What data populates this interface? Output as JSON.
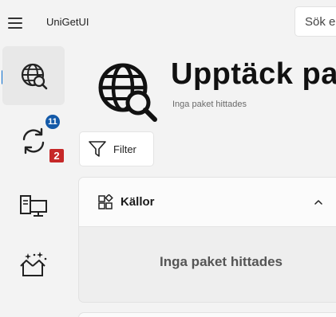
{
  "titlebar": {
    "app_name": "UniGetUI",
    "search_text": "Sök e"
  },
  "nav": {
    "items": [
      {
        "id": "discover",
        "icon": "globe-search-icon",
        "selected": true
      },
      {
        "id": "updates",
        "icon": "sync-icon",
        "badge": "11",
        "extra_badge": "2"
      },
      {
        "id": "installed",
        "icon": "desktop-packages-icon"
      },
      {
        "id": "bundles",
        "icon": "sparkle-box-icon"
      }
    ]
  },
  "header": {
    "title": "Upptäck pa",
    "subtitle": "Inga paket hittades"
  },
  "toolbar": {
    "filter_label": "Filter"
  },
  "sources": {
    "label": "Källor",
    "empty_text": "Inga paket hittades"
  },
  "colors": {
    "accent": "#0b6ed0",
    "badge_blue": "#1359a8",
    "badge_red": "#c62828",
    "background": "#f3f3f3"
  }
}
